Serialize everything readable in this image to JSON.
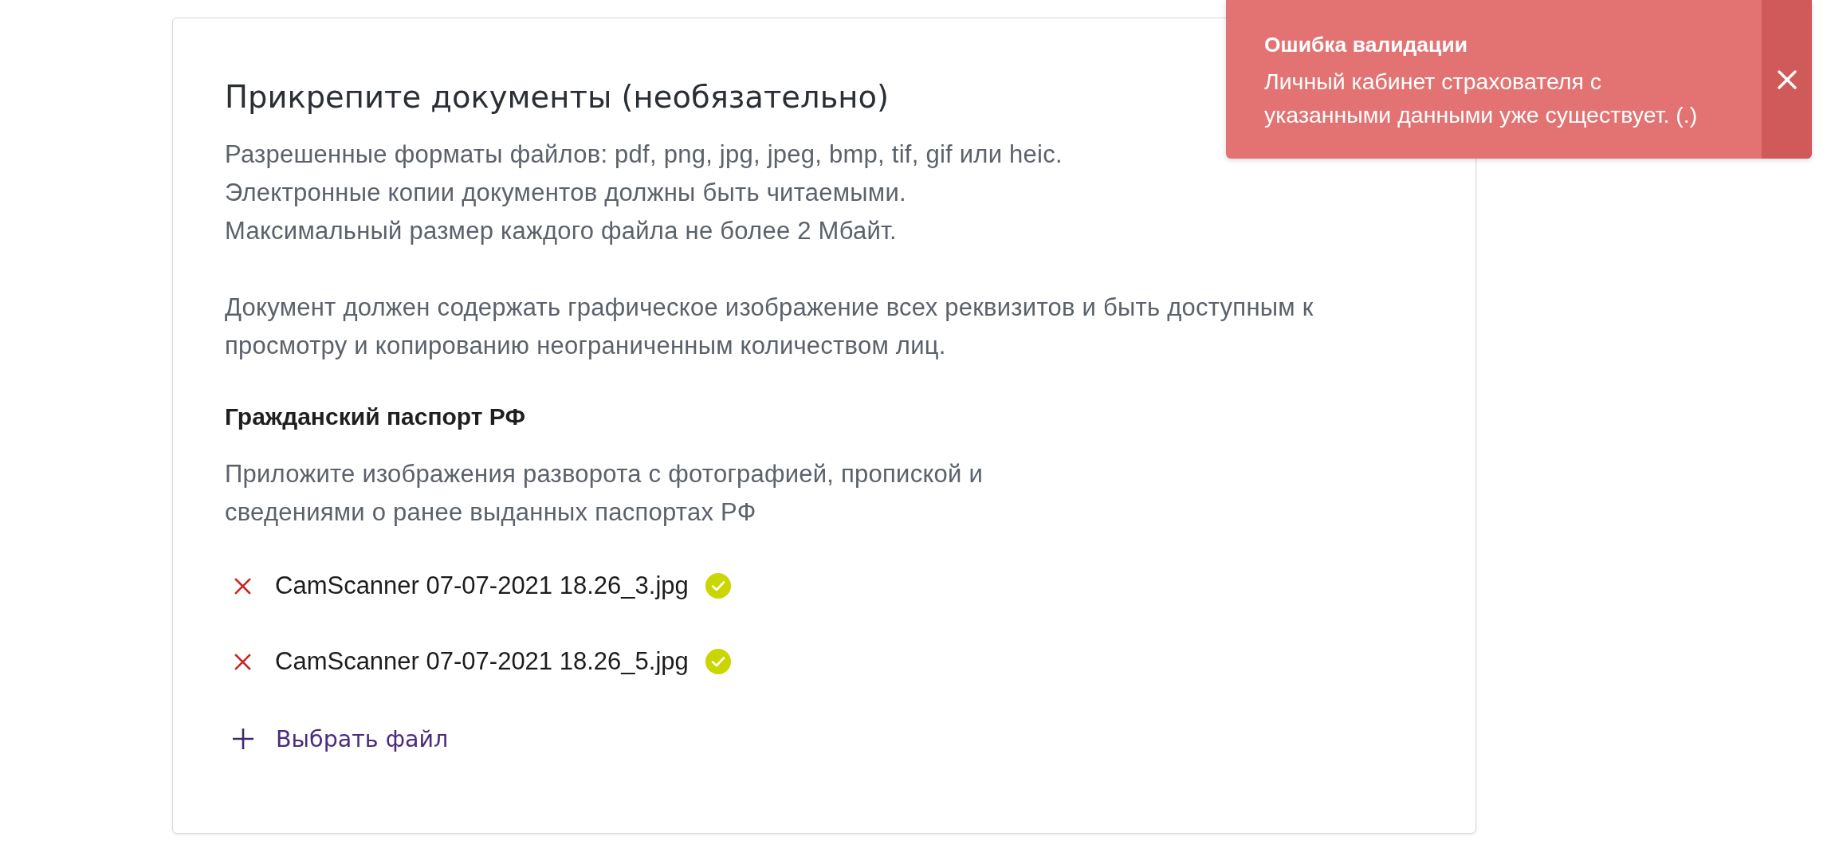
{
  "card": {
    "title": "Прикрепите документы (необязательно)",
    "requirements": [
      "Разрешенные форматы файлов: pdf, png, jpg, jpeg, bmp, tif, gif или heic.",
      "Электронные копии документов должны быть читаемыми.",
      "Максимальный размер каждого файла не более 2 Мбайт."
    ],
    "note": [
      "Документ должен содержать графическое изображение всех реквизитов и быть доступным к",
      "просмотру и копированию неограниченным количеством лиц."
    ],
    "document": {
      "title": "Гражданский паспорт РФ",
      "hint": [
        "Приложите изображения разворота с фотографией, пропиской и",
        "сведениями о ранее выданных паспортах РФ"
      ],
      "files": [
        {
          "name": "CamScanner 07-07-2021 18.26_3.jpg",
          "uploaded": true
        },
        {
          "name": "CamScanner 07-07-2021 18.26_5.jpg",
          "uploaded": true
        }
      ],
      "add_button": "Выбрать файл"
    }
  },
  "toast": {
    "title": "Ошибка валидации",
    "message": [
      "Личный кабинет страхователя с",
      "указанными данными уже существует. (.)"
    ]
  }
}
